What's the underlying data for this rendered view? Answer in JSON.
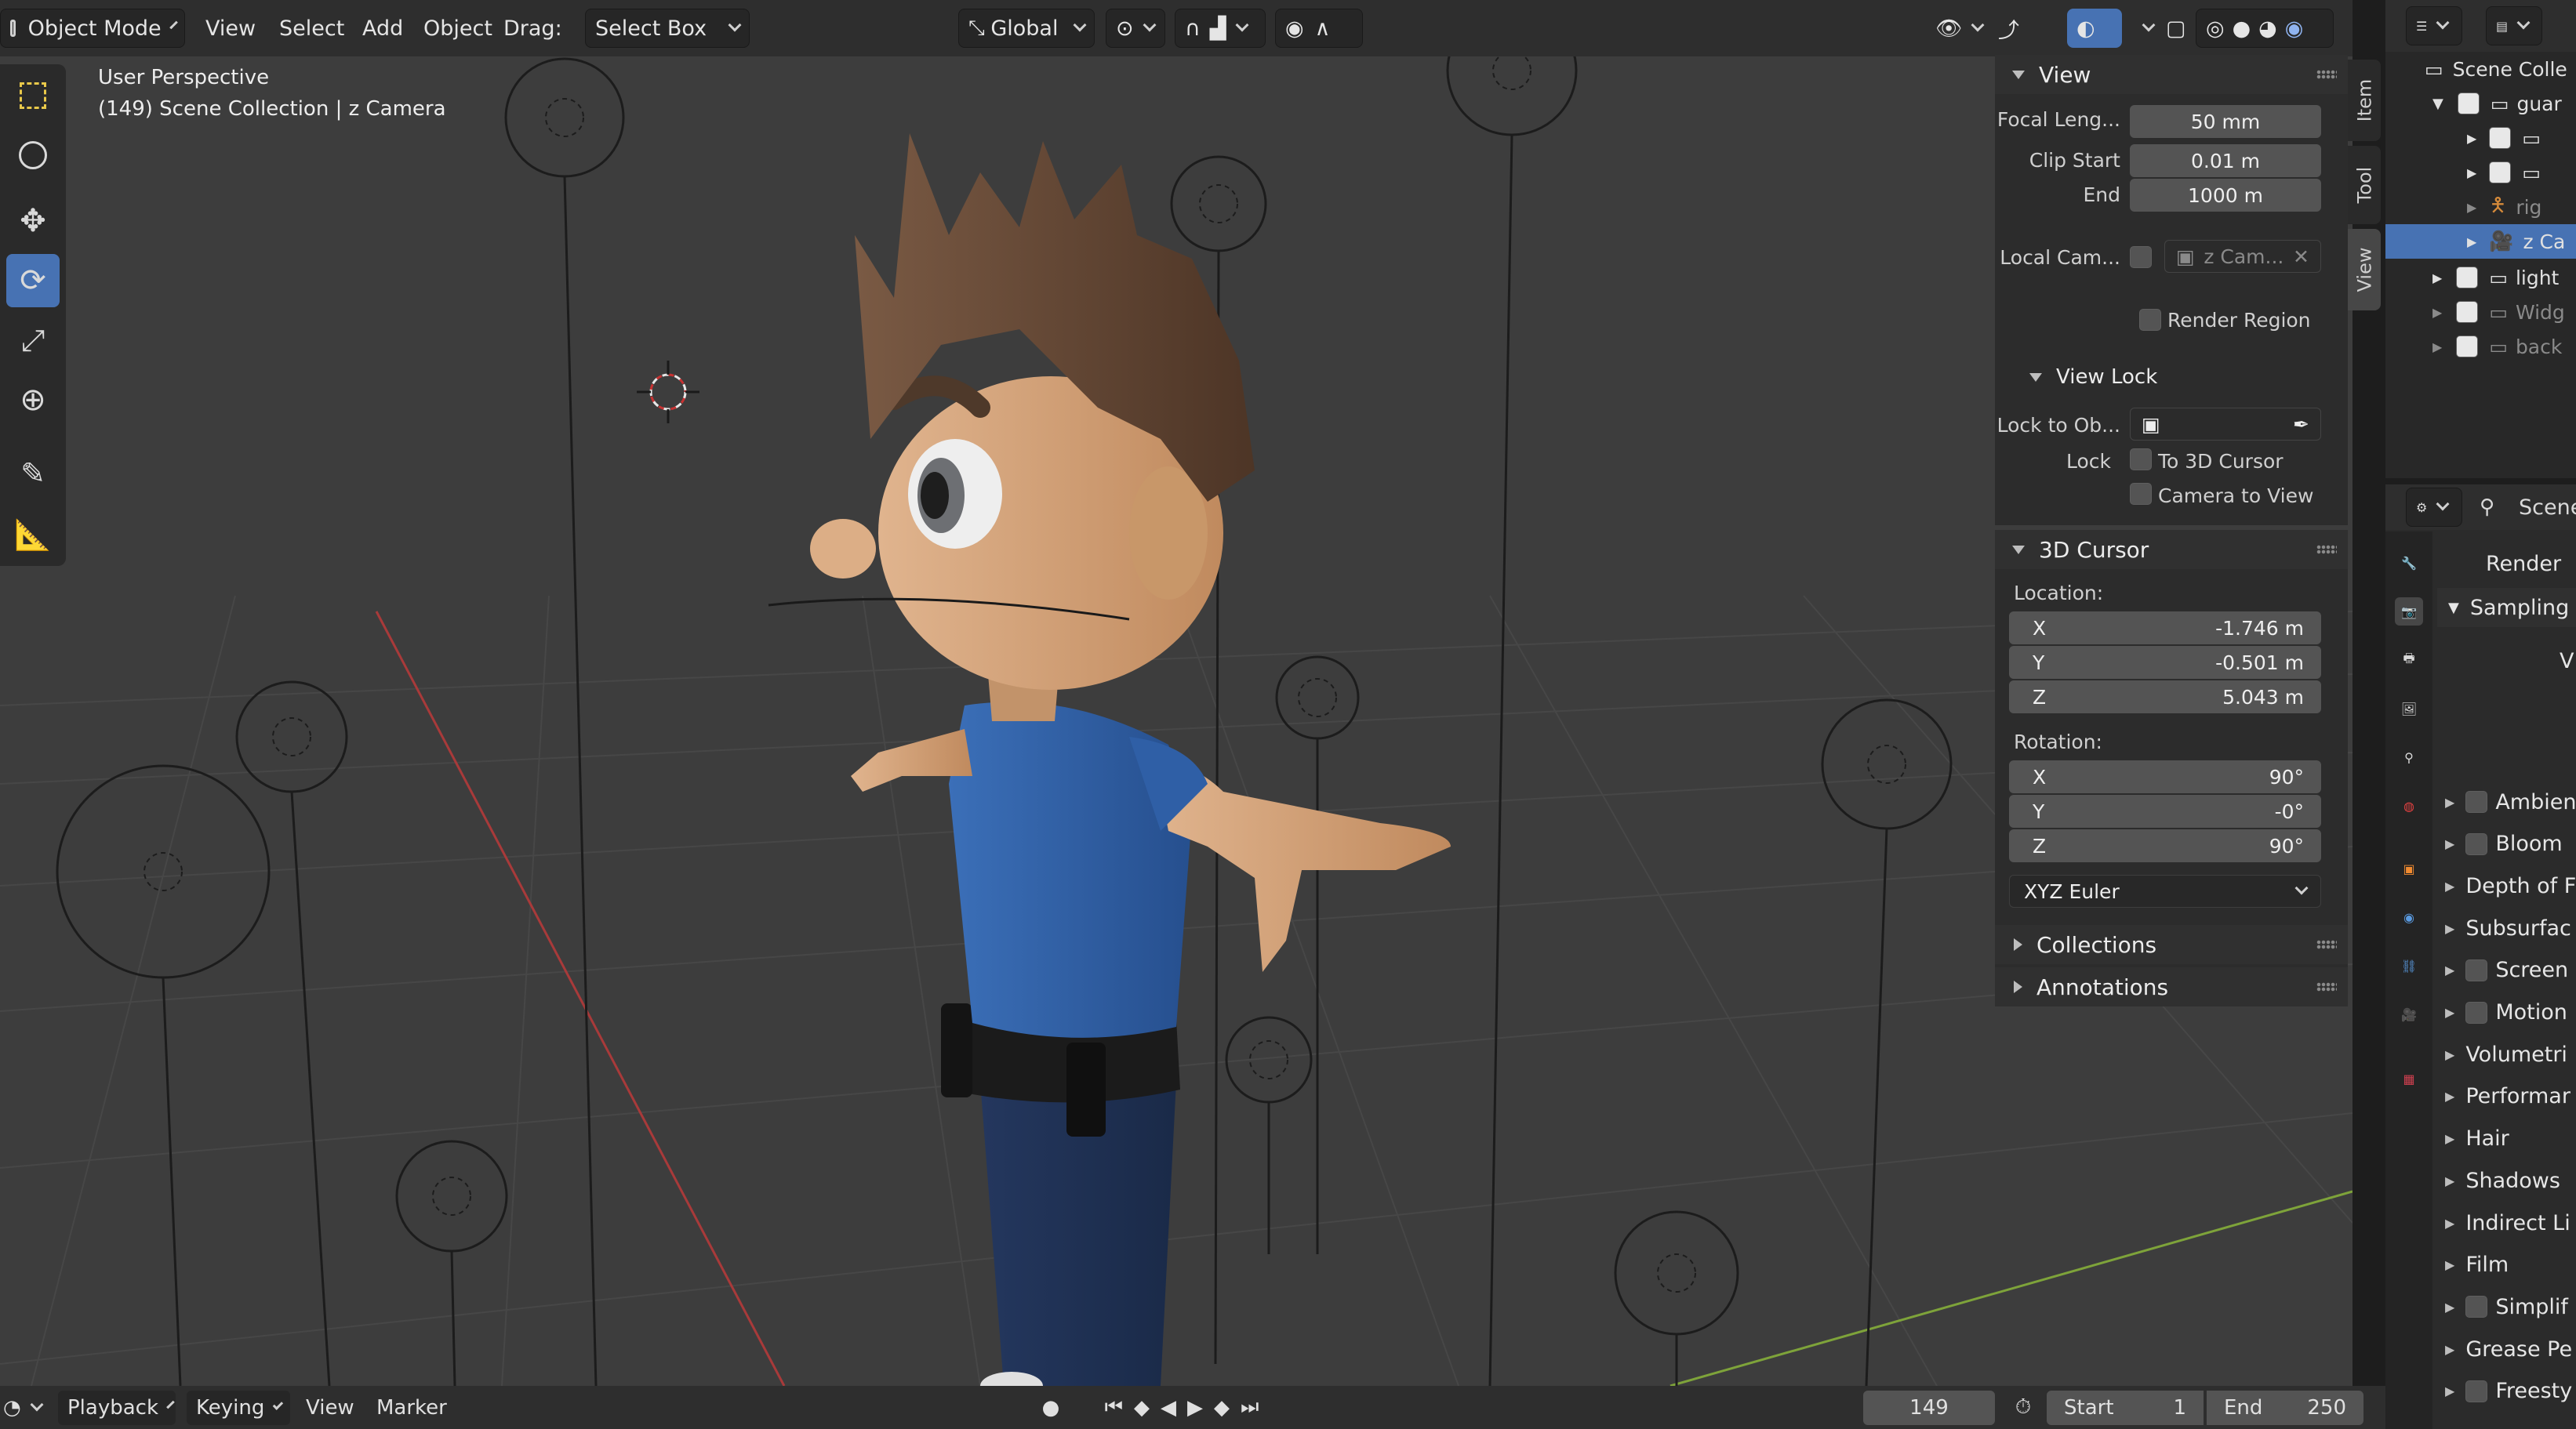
{
  "header": {
    "mode": "Object Mode",
    "menu_view": "View",
    "menu_select": "Select",
    "menu_add": "Add",
    "menu_object": "Object",
    "drag_label": "Drag:",
    "drag_value": "Select Box",
    "orientation": "Global"
  },
  "viewport": {
    "perspective": "User Perspective",
    "collection_info": "(149) Scene Collection | z Camera"
  },
  "npanel": {
    "view_title": "View",
    "focal_label": "Focal Leng...",
    "focal_value": "50 mm",
    "clip_start_label": "Clip Start",
    "clip_start_value": "0.01 m",
    "clip_end_label": "End",
    "clip_end_value": "1000 m",
    "local_cam_label": "Local Cam...",
    "local_cam_value": "z Cam...",
    "render_region": "Render Region",
    "view_lock_title": "View Lock",
    "lock_to_obj_label": "Lock to Ob...",
    "lock_label": "Lock",
    "to_3d_cursor": "To 3D Cursor",
    "camera_to_view": "Camera to View",
    "cursor_title": "3D Cursor",
    "location_label": "Location:",
    "loc_x_label": "X",
    "loc_x": "-1.746 m",
    "loc_y_label": "Y",
    "loc_y": "-0.501 m",
    "loc_z_label": "Z",
    "loc_z": "5.043 m",
    "rotation_label": "Rotation:",
    "rot_x_label": "X",
    "rot_x": "90°",
    "rot_y_label": "Y",
    "rot_y": "-0°",
    "rot_z_label": "Z",
    "rot_z": "90°",
    "rotation_mode": "XYZ Euler",
    "collections_title": "Collections",
    "annotations_title": "Annotations"
  },
  "side_tabs": [
    "Item",
    "Tool",
    "View"
  ],
  "outliner": {
    "root": "Scene Colle",
    "rows": [
      "guar",
      "",
      "",
      "rig",
      "z Ca",
      "light",
      "Widg",
      "back"
    ]
  },
  "properties": {
    "scene_label": "Scene",
    "render_label": "Render",
    "sampling": "Sampling",
    "viewport_short": "V",
    "rows": [
      "Ambien",
      "Bloom",
      "Depth of F",
      "Subsurfac",
      "Screen",
      "Motion",
      "Volumetri",
      "Performar",
      "Hair",
      "Shadows",
      "Indirect Li",
      "Film",
      "Simplif",
      "Grease Pe",
      "Freesty"
    ]
  },
  "timeline": {
    "playback": "Playback",
    "keying": "Keying",
    "view": "View",
    "marker": "Marker",
    "current_frame": "149",
    "start_label": "Start",
    "start_value": "1",
    "end_label": "End",
    "end_value": "250"
  },
  "colors": {
    "accent": "#4772b3",
    "viewport_bg": "#3d3d3d",
    "panel_bg": "#2c2c2c",
    "x_axis": "#a83a3a",
    "y_axis": "#7ea33a"
  }
}
